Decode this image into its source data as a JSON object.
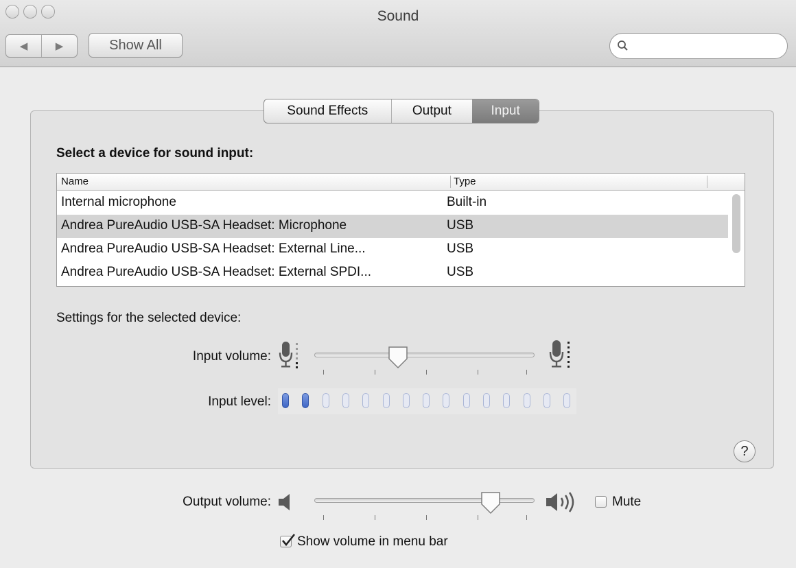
{
  "window": {
    "title": "Sound"
  },
  "toolbar": {
    "back_glyph": "◀",
    "forward_glyph": "▶",
    "show_all_label": "Show All",
    "search_placeholder": ""
  },
  "tabs": [
    {
      "label": "Sound Effects",
      "active": false
    },
    {
      "label": "Output",
      "active": false
    },
    {
      "label": "Input",
      "active": true
    }
  ],
  "input_section": {
    "heading": "Select a device for sound input:",
    "columns": [
      "Name",
      "Type"
    ],
    "devices": [
      {
        "name": "Internal microphone",
        "type": "Built-in",
        "selected": false
      },
      {
        "name": "Andrea PureAudio USB-SA Headset: Microphone",
        "type": "USB",
        "selected": true
      },
      {
        "name": "Andrea PureAudio USB-SA Headset: External Line...",
        "type": "USB",
        "selected": false
      },
      {
        "name": "Andrea PureAudio USB-SA Headset: External SPDI...",
        "type": "USB",
        "selected": false
      }
    ],
    "settings_label": "Settings for the selected device:",
    "input_volume_label": "Input volume:",
    "input_volume_value": 0.38,
    "input_level_label": "Input level:",
    "input_level_total": 15,
    "input_level_lit": 2
  },
  "help_glyph": "?",
  "output": {
    "volume_label": "Output volume:",
    "volume_value": 0.8,
    "mute_label": "Mute",
    "mute_checked": false,
    "show_in_menubar_label": "Show volume in menu bar",
    "show_in_menubar_checked": true
  },
  "colors": {
    "selection": "#d4d4d4",
    "level_on": "#3f66c4",
    "level_off": "#e6e9f3"
  }
}
